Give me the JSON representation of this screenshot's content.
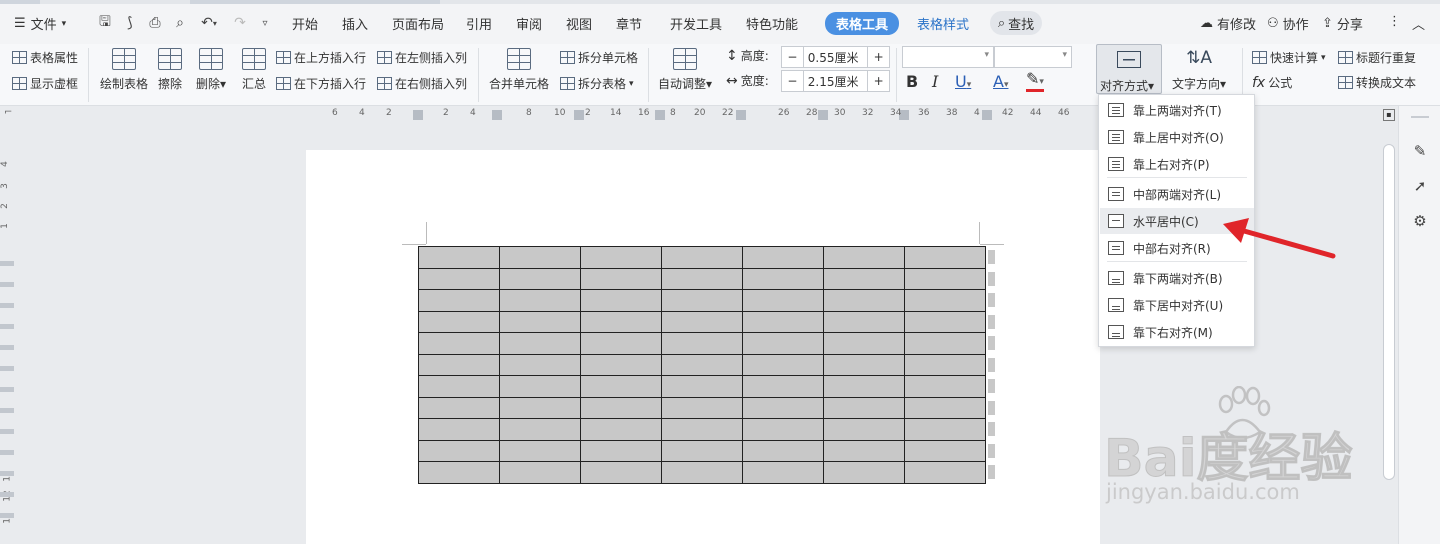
{
  "menubar": {
    "file_label": "文件",
    "tabs": [
      {
        "label": "开始"
      },
      {
        "label": "插入"
      },
      {
        "label": "页面布局"
      },
      {
        "label": "引用"
      },
      {
        "label": "审阅"
      },
      {
        "label": "视图"
      },
      {
        "label": "章节"
      },
      {
        "label": "开发工具"
      },
      {
        "label": "特色功能"
      },
      {
        "label": "表格工具",
        "active": true
      },
      {
        "label": "表格样式"
      }
    ],
    "search_label": "查找",
    "right": {
      "modified": "有修改",
      "collab": "协作",
      "share": "分享"
    }
  },
  "ribbon": {
    "table_props": "表格属性",
    "show_gridlines": "显示虚框",
    "draw_table": "绘制表格",
    "erase": "擦除",
    "delete": "删除",
    "summary": "汇总",
    "insert_row_above": "在上方插入行",
    "insert_row_below": "在下方插入行",
    "insert_col_left": "在左侧插入列",
    "insert_col_right": "在右侧插入列",
    "merge_cells": "合并单元格",
    "split_cells": "拆分单元格",
    "split_table": "拆分表格",
    "auto_fit": "自动调整",
    "height_label": "高度:",
    "height_value": "0.55厘米",
    "width_label": "宽度:",
    "width_value": "2.15厘米",
    "align": "对齐方式",
    "text_direction": "文字方向",
    "quick_calc": "快速计算",
    "repeat_header": "标题行重复",
    "formula": "公式",
    "to_text": "转换成文本"
  },
  "ruler_top_ticks": [
    "6",
    "4",
    "2",
    "2",
    "4",
    "8",
    "10",
    "2",
    "14",
    "16",
    "8",
    "20",
    "22",
    "26",
    "28",
    "30",
    "32",
    "34",
    "36",
    "38",
    "4",
    "42",
    "44",
    "46"
  ],
  "ruler_left_ticks": [
    "4",
    "3",
    "2",
    "1",
    "11",
    "12",
    "13"
  ],
  "align_menu": {
    "items": [
      {
        "label": "靠上两端对齐(T)"
      },
      {
        "label": "靠上居中对齐(O)"
      },
      {
        "label": "靠上右对齐(P)"
      },
      {
        "label": "中部两端对齐(L)"
      },
      {
        "label": "水平居中(C)",
        "highlighted": true
      },
      {
        "label": "中部右对齐(R)"
      },
      {
        "label": "靠下两端对齐(B)"
      },
      {
        "label": "靠下居中对齐(U)"
      },
      {
        "label": "靠下右对齐(M)"
      }
    ]
  },
  "document_table": {
    "rows": 11,
    "cols": 7,
    "cell_color": "#c8c8c8"
  },
  "colors": {
    "accent": "#4a90e2",
    "arrow": "#e0252a",
    "highlight": "#eaecef"
  },
  "watermark": {
    "logo": "Bai度经验",
    "url": "jingyan.baidu.com"
  }
}
